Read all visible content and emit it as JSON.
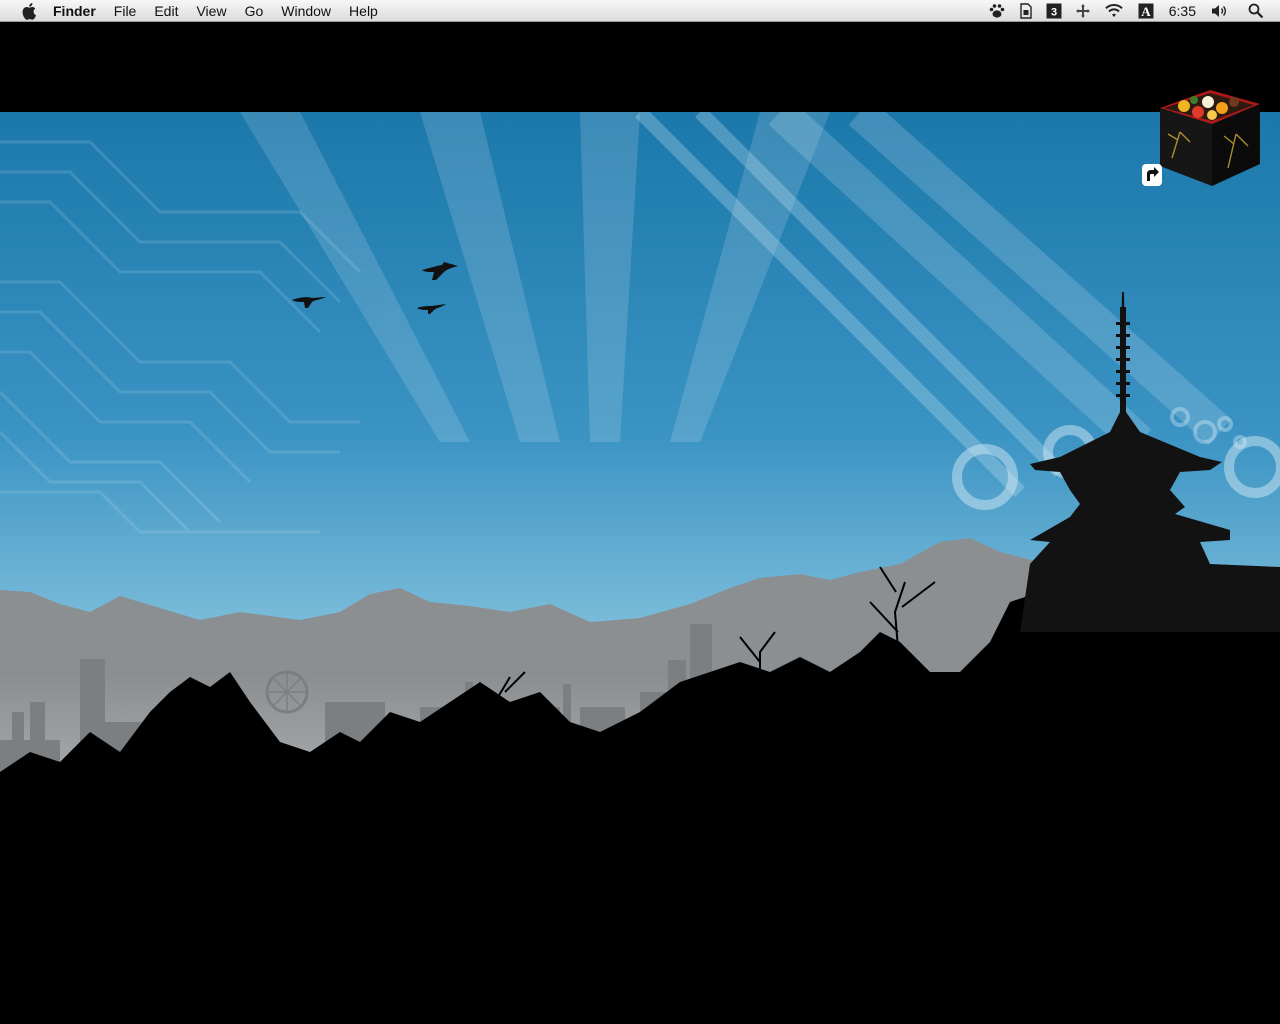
{
  "menubar": {
    "apple_icon": "apple-logo-icon",
    "app_name": "Finder",
    "menus": [
      "File",
      "Edit",
      "View",
      "Go",
      "Window",
      "Help"
    ],
    "status_icons": [
      "paw-icon",
      "sd-card-icon",
      "spaces-icon",
      "move-icon",
      "wifi-icon",
      "input-source-icon"
    ],
    "input_source_label": "A",
    "clock": "6:35",
    "volume_icon": "volume-icon",
    "search_icon": "spotlight-search-icon"
  },
  "desktop": {
    "wallpaper": "city-skyline-pagoda-birds",
    "icon": {
      "name": "bento-box-alias-icon",
      "alias_arrow": "alias-arrow-icon"
    }
  },
  "colors": {
    "sky_top": "#1f7fb0",
    "sky_bottom": "#9bd0e6",
    "mountains": "#8f9294",
    "silhouette": "#000000"
  }
}
